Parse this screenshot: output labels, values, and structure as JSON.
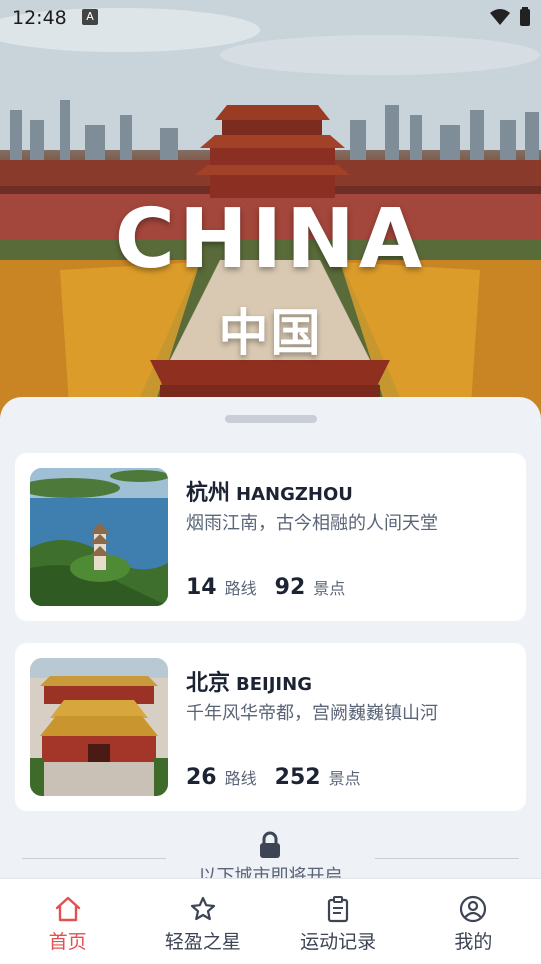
{
  "status_bar": {
    "time": "12:48",
    "indicator": "A"
  },
  "hero": {
    "title": "CHINA",
    "subtitle": "中国"
  },
  "cities": [
    {
      "name_cn": "杭州",
      "name_en": "HANGZHOU",
      "tagline": "烟雨江南，古今相融的人间天堂",
      "routes": "14",
      "routes_unit": "路线",
      "spots": "92",
      "spots_unit": "景点",
      "image": "west-lake-pagoda"
    },
    {
      "name_cn": "北京",
      "name_en": "BEIJING",
      "tagline": "千年风华帝都，宫阙巍巍镇山河",
      "routes": "26",
      "routes_unit": "路线",
      "spots": "252",
      "spots_unit": "景点",
      "image": "forbidden-city-gate"
    }
  ],
  "locked_section": {
    "text": "以下城市即将开启",
    "icon": "lock-icon"
  },
  "nav": [
    {
      "label": "首页",
      "icon": "home-icon",
      "active": true
    },
    {
      "label": "轻盈之星",
      "icon": "star-icon",
      "active": false
    },
    {
      "label": "运动记录",
      "icon": "clipboard-icon",
      "active": false
    },
    {
      "label": "我的",
      "icon": "user-icon",
      "active": false
    }
  ],
  "colors": {
    "accent": "#e35050",
    "text_primary": "#1c2333",
    "text_secondary": "#5b6578",
    "background": "#eef1f6"
  }
}
